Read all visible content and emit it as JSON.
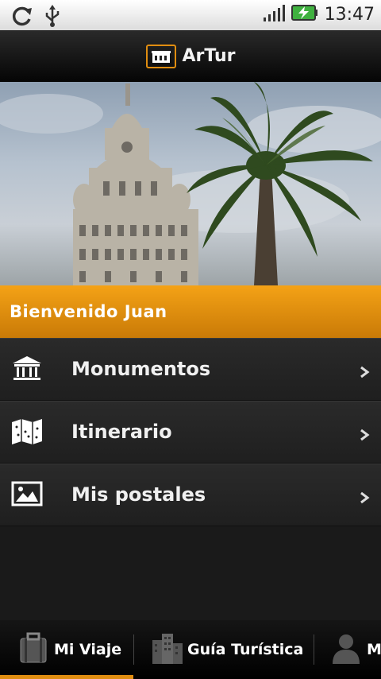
{
  "status_bar": {
    "time": "13:47"
  },
  "app": {
    "title": "ArTur"
  },
  "welcome": {
    "text": "Bienvenido Juan"
  },
  "menu": {
    "items": [
      {
        "label": "Monumentos",
        "icon": "monument-icon"
      },
      {
        "label": "Itinerario",
        "icon": "map-icon"
      },
      {
        "label": "Mis postales",
        "icon": "picture-icon"
      }
    ]
  },
  "tabs": [
    {
      "label": "Mi Viaje",
      "icon": "suitcase-icon",
      "selected": true
    },
    {
      "label": "Guía Turística",
      "icon": "buildings-icon",
      "selected": false
    },
    {
      "label": "M",
      "icon": "person-icon",
      "selected": false
    }
  ],
  "colors": {
    "accent": "#e08d10",
    "welcome_bar": "#f4a216",
    "background": "#1a1a1a"
  }
}
